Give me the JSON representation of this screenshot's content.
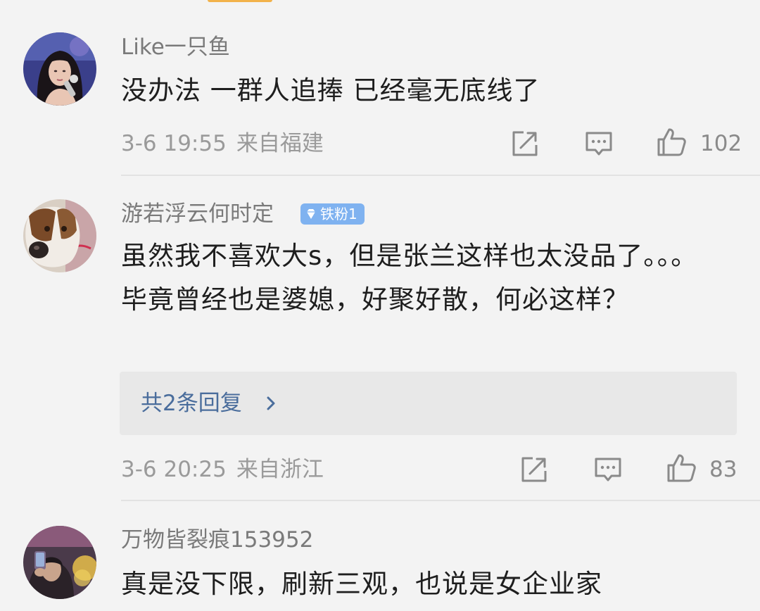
{
  "comments": [
    {
      "username": "Like一只鱼",
      "content": "没办法 一群人追捧 已经毫无底线了",
      "date": "3-6 19:55",
      "location": "来自福建",
      "likes": "102",
      "avatar": "singer-photo"
    },
    {
      "username": "游若浮云何时定",
      "badge": "铁粉1",
      "content": "虽然我不喜欢大s，但是张兰这样也太没品了。。。毕竟曾经也是婆媳，好聚好散，何必这样？",
      "replies": "共2条回复",
      "date": "3-6 20:25",
      "location": "来自浙江",
      "likes": "83",
      "avatar": "dog-photo"
    },
    {
      "username": "万物皆裂痕153952",
      "content": "真是没下限，刷新三观，也说是女企业家",
      "avatar": "person-with-phone-photo"
    }
  ],
  "icons": {
    "repost": "repost-icon",
    "comment": "comment-icon",
    "like": "thumbs-up-icon",
    "badge": "diamond-icon",
    "chevron": "chevron-right-icon"
  },
  "colors": {
    "username": "#7a7a7a",
    "content": "#1e1e1e",
    "meta": "#9a9a9a",
    "reply_link": "#4a6d9c",
    "badge_bg": "#7fb2f0",
    "background": "#f3f3f3"
  }
}
